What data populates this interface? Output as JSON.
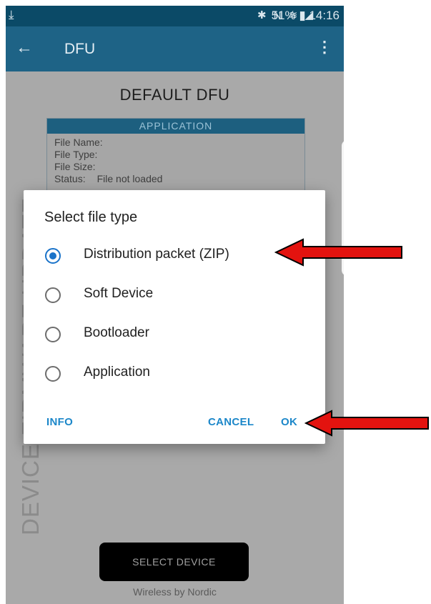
{
  "status_bar": {
    "download_icon": "download-icon",
    "icons_text": "✱ N ≋ ◢",
    "battery": "51%",
    "time": "14:16"
  },
  "toolbar": {
    "title": "DFU",
    "back_icon": "back-arrow-icon",
    "menu_icon": "more-vert-icon"
  },
  "background": {
    "heading": "DEFAULT DFU",
    "vertical_text": "DEVICE FIRMWARE UPDATE",
    "panel": {
      "header": "APPLICATION",
      "rows": [
        {
          "label": "File Name:",
          "value": ""
        },
        {
          "label": "File Type:",
          "value": ""
        },
        {
          "label": "File Size:",
          "value": ""
        },
        {
          "label": "Status:",
          "value": "File not loaded"
        }
      ]
    },
    "select_device": "SELECT DEVICE",
    "footer": "Wireless by Nordic"
  },
  "dialog": {
    "title": "Select file type",
    "options": [
      {
        "label": "Distribution packet (ZIP)",
        "selected": true
      },
      {
        "label": "Soft Device",
        "selected": false
      },
      {
        "label": "Bootloader",
        "selected": false
      },
      {
        "label": "Application",
        "selected": false
      }
    ],
    "info": "INFO",
    "cancel": "CANCEL",
    "ok": "OK"
  },
  "colors": {
    "accent": "#1a73c9",
    "toolbar": "#1e6386",
    "statusbar": "#0b4a67",
    "arrow": "#e3130f"
  }
}
